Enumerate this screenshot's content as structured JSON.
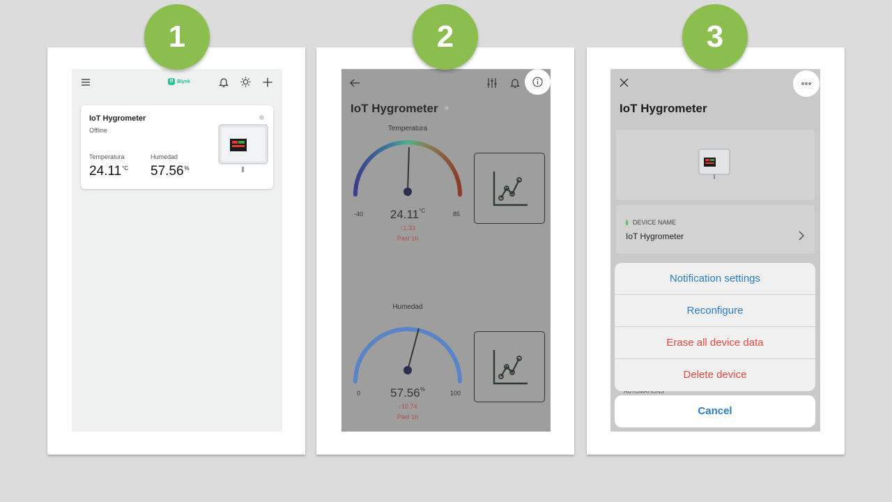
{
  "steps": [
    "1",
    "2",
    "3"
  ],
  "screen1": {
    "logo": "Blynk",
    "device": {
      "name": "IoT Hygrometer",
      "status": "Offline",
      "metrics": [
        {
          "label": "Temperatura",
          "value": "24.11",
          "unit": "°C"
        },
        {
          "label": "Humedad",
          "value": "57.56",
          "unit": "%"
        }
      ]
    }
  },
  "screen2": {
    "title": "IoT Hygrometer",
    "gauges": [
      {
        "label": "Temperatura",
        "value": "24.11",
        "unit": "°C",
        "min": "-40",
        "max": "85",
        "delta": "↑1.33",
        "period": "Past 1h"
      },
      {
        "label": "Humedad",
        "value": "57.56",
        "unit": "%",
        "min": "0",
        "max": "100",
        "delta": "↑10.74",
        "period": "Past 1h"
      }
    ],
    "colors": {
      "temp_cold": "#3a3f8a",
      "temp_mid": "#4fb08a",
      "temp_hot": "#8a3b26",
      "humidity": "#5a84c8"
    }
  },
  "screen3": {
    "title": "IoT Hygrometer",
    "device_name_caption": "DEVICE NAME",
    "device_name_value": "IoT Hygrometer",
    "automations_label": "AUTOMATIONS",
    "actions": [
      {
        "label": "Notification settings",
        "kind": "normal"
      },
      {
        "label": "Reconfigure",
        "kind": "normal"
      },
      {
        "label": "Erase all device data",
        "kind": "destructive"
      },
      {
        "label": "Delete device",
        "kind": "destructive"
      }
    ],
    "cancel": "Cancel"
  }
}
